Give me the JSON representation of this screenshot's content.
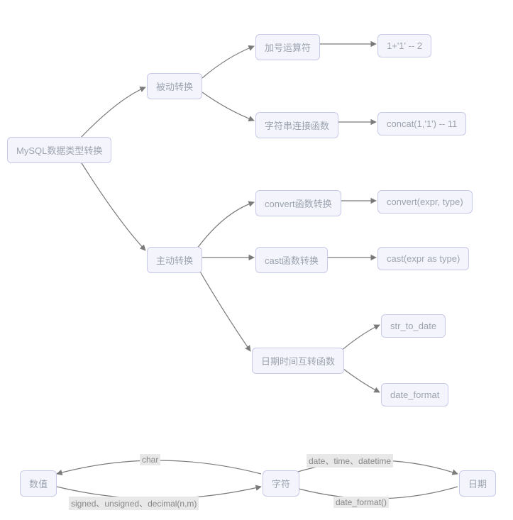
{
  "nodes": {
    "root": "MySQL数据类型转换",
    "passive": "被动转换",
    "active": "主动转换",
    "plusOp": "加号运算符",
    "concatFn": "字符串连接函数",
    "convertFn": "convert函数转换",
    "castFn": "cast函数转换",
    "dateFn": "日期时间互转函数",
    "plusEx": "1+'1' -- 2",
    "concatEx": "concat(1,'1') -- 11",
    "convertEx": "convert(expr, type)",
    "castEx": "cast(expr as type)",
    "strToDate": "str_to_date",
    "dateFormat": "date_format",
    "numVal": "数值",
    "strVal": "字符",
    "dateVal": "日期"
  },
  "edgeLabels": {
    "charLbl": "char",
    "signedLbl": "signed、unsigned、decimal(n,m)",
    "dateTypesLbl": "date、time、datetime",
    "dateFmtLbl": "date_format()"
  }
}
